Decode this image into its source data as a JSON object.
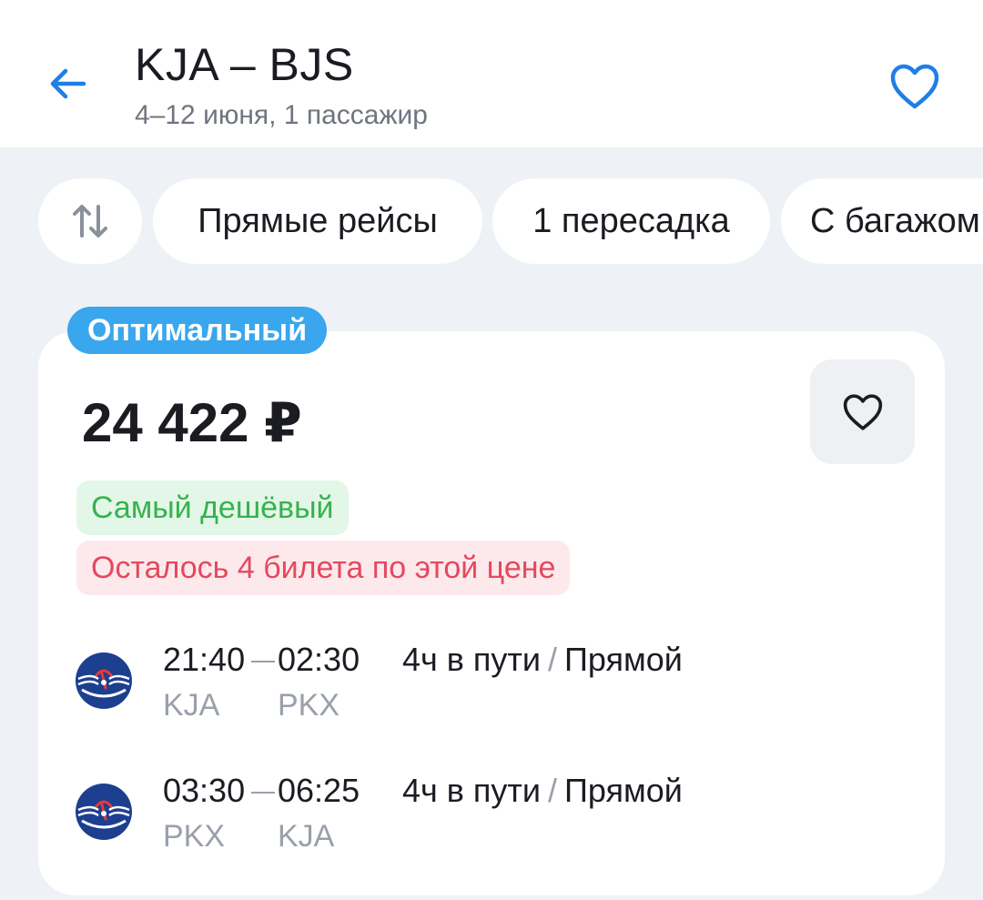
{
  "header": {
    "title": "KJA – BJS",
    "subtitle": "4–12 июня, 1 пассажир",
    "back_icon": "arrow-left-icon",
    "favorite_icon": "heart-outline-icon"
  },
  "filters": {
    "sort_icon": "sort-arrows-icon",
    "chips": [
      "Прямые рейсы",
      "1 пересадка",
      "С багажом"
    ]
  },
  "card": {
    "badge": "Оптимальный",
    "price": "24 422 ₽",
    "favorite_icon": "heart-outline-icon",
    "tags": {
      "cheapest": "Самый дешёвый",
      "remaining": "Осталось 4 билета по этой цене"
    },
    "segments": [
      {
        "dep_time": "21:40",
        "arr_time": "02:30",
        "dep_code": "KJA",
        "arr_code": "PKX",
        "duration": "4ч в пути",
        "separator": "/",
        "type": "Прямой",
        "airline_logo": "aeroflot-logo"
      },
      {
        "dep_time": "03:30",
        "arr_time": "06:25",
        "dep_code": "PKX",
        "arr_code": "KJA",
        "duration": "4ч в пути",
        "separator": "/",
        "type": "Прямой",
        "airline_logo": "aeroflot-logo"
      }
    ]
  },
  "colors": {
    "accent": "#1e7fe6",
    "badge_bg": "#3aa6ee",
    "green_text": "#37b24d",
    "green_bg": "#e3f7e8",
    "red_text": "#e5485e",
    "red_bg": "#fde9ec",
    "page_bg": "#eef1f5"
  }
}
